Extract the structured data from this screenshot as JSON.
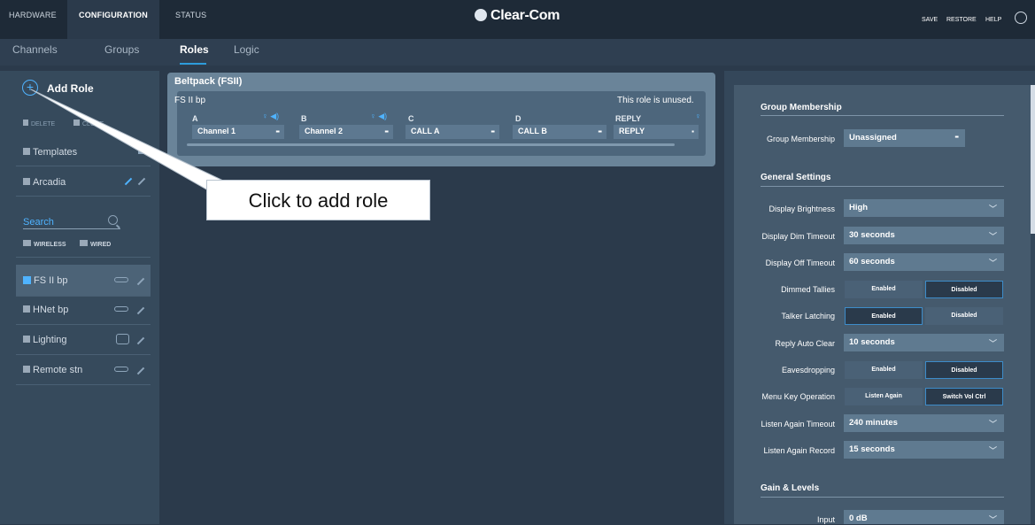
{
  "topbar": {
    "tabs": [
      {
        "label": "HARDWARE"
      },
      {
        "label": "CONFIGURATION"
      },
      {
        "label": "STATUS"
      }
    ],
    "logo": "Clear-Com",
    "actions": {
      "save": "SAVE",
      "restore": "RESTORE",
      "help": "HELP"
    }
  },
  "subnav": {
    "tabs": [
      {
        "label": "Channels"
      },
      {
        "label": "Groups"
      },
      {
        "label": "Roles"
      },
      {
        "label": "Logic"
      }
    ]
  },
  "sidebar": {
    "add_role": "Add Role",
    "delete": "DELETE",
    "clone": "CLONE",
    "templates": "Templates",
    "arcadia": "Arcadia",
    "search": "Search",
    "filters": [
      "WIRELESS",
      "WIRED"
    ],
    "roles": [
      {
        "label": "FS II bp"
      },
      {
        "label": "HNet bp"
      },
      {
        "label": "Lighting"
      },
      {
        "label": "Remote stn"
      }
    ]
  },
  "beltpack": {
    "title": "Beltpack (FSII)",
    "subtitle": "FS II bp",
    "unused": "This role is unused.",
    "keys": [
      {
        "key": "A",
        "channel": "Channel 1"
      },
      {
        "key": "B",
        "channel": "Channel 2"
      },
      {
        "key": "C",
        "channel": "CALL A"
      },
      {
        "key": "D",
        "channel": "CALL B"
      },
      {
        "key": "REPLY",
        "channel": "REPLY"
      }
    ]
  },
  "callout": "Click to add role",
  "settings": {
    "group_membership": {
      "header": "Group Membership",
      "label": "Group Membership",
      "value": "Unassigned"
    },
    "general": {
      "header": "General Settings",
      "display_brightness": {
        "label": "Display Brightness",
        "value": "High"
      },
      "display_dim_timeout": {
        "label": "Display Dim Timeout",
        "value": "30 seconds"
      },
      "display_off_timeout": {
        "label": "Display Off Timeout",
        "value": "60 seconds"
      },
      "dimmed_tallies": {
        "label": "Dimmed Tallies",
        "opt1": "Enabled",
        "opt2": "Disabled"
      },
      "talker_latching": {
        "label": "Talker Latching",
        "opt1": "Enabled",
        "opt2": "Disabled"
      },
      "reply_auto_clear": {
        "label": "Reply Auto Clear",
        "value": "10 seconds"
      },
      "eavesdropping": {
        "label": "Eavesdropping",
        "opt1": "Enabled",
        "opt2": "Disabled"
      },
      "menu_key_operation": {
        "label": "Menu Key Operation",
        "opt1": "Listen Again",
        "opt2": "Switch Vol Ctrl"
      },
      "listen_again_timeout": {
        "label": "Listen Again Timeout",
        "value": "240 minutes"
      },
      "listen_again_record": {
        "label": "Listen Again Record",
        "value": "15 seconds"
      }
    },
    "gain": {
      "header": "Gain & Levels",
      "input": {
        "label": "Input",
        "value": "0 dB"
      }
    }
  }
}
